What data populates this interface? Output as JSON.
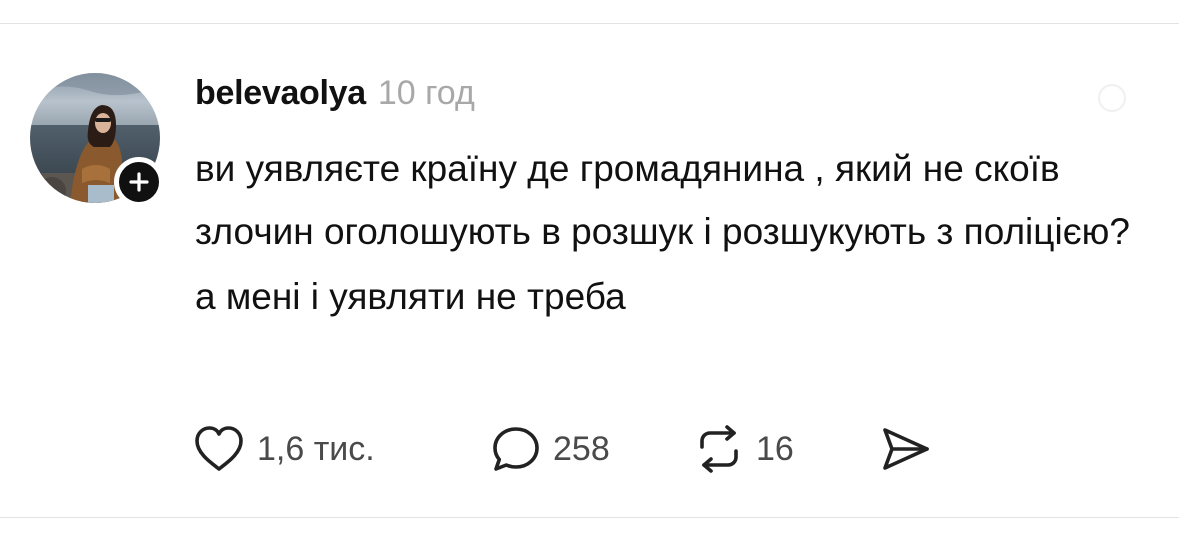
{
  "comment": {
    "author": {
      "username": "belevaolya",
      "avatar_icon": "profile-photo",
      "follow_icon": "plus-icon"
    },
    "timestamp": "10 год",
    "paragraphs": [
      "ви уявляєте країну де громадянина , який не скоїв злочин оголошують в розшук і розшукують з поліцією?",
      "а мені і уявляти не треба"
    ],
    "actions": {
      "like": {
        "icon": "heart-icon",
        "count": "1,6 тис."
      },
      "reply": {
        "icon": "comment-bubble-icon",
        "count": "258"
      },
      "repost": {
        "icon": "repost-icon",
        "count": "16"
      },
      "share": {
        "icon": "send-icon"
      }
    }
  },
  "colors": {
    "text": "#111111",
    "muted": "#a8a8a8",
    "count": "#4a4a4a",
    "divider": "#e3e3e3"
  }
}
